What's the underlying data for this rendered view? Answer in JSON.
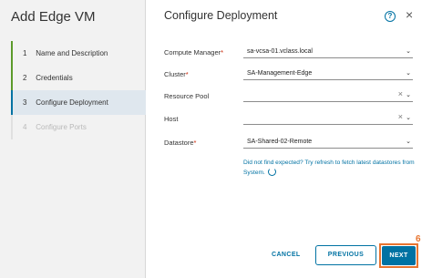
{
  "wizard": {
    "title": "Add Edge VM",
    "steps": [
      {
        "num": "1",
        "label": "Name and Description"
      },
      {
        "num": "2",
        "label": "Credentials"
      },
      {
        "num": "3",
        "label": "Configure Deployment"
      },
      {
        "num": "4",
        "label": "Configure Ports"
      }
    ]
  },
  "main": {
    "title": "Configure Deployment",
    "help_icon": "?",
    "close_icon": "×",
    "fields": {
      "compute_manager": {
        "label": "Compute Manager",
        "required": "*",
        "value": "sa-vcsa-01.vclass.local"
      },
      "cluster": {
        "label": "Cluster",
        "required": "*",
        "value": "SA-Management-Edge"
      },
      "resource_pool": {
        "label": "Resource Pool",
        "value": ""
      },
      "host": {
        "label": "Host",
        "value": ""
      },
      "datastore": {
        "label": "Datastore",
        "required": "*",
        "value": "SA-Shared-02-Remote"
      }
    },
    "hint": "Did not find expected? Try refresh to fetch latest datastores from System.",
    "clear_glyph": "×",
    "chevron_glyph": "⌄"
  },
  "footer": {
    "cancel_label": "CANCEL",
    "previous_label": "PREVIOUS",
    "next_label": "NEXT",
    "callout_number": "6"
  },
  "colors": {
    "accent": "#0072a3",
    "highlight": "#e8742f",
    "step_done": "#5c9a2b",
    "required": "#c92100"
  }
}
